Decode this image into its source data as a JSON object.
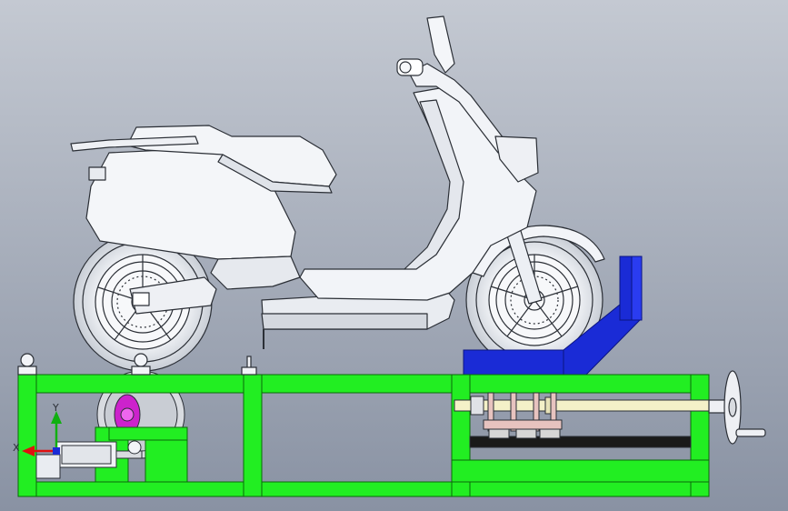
{
  "triad": {
    "x_label": "X",
    "y_label": "Y",
    "x_color": "#e01010",
    "y_color": "#10b010"
  },
  "colors": {
    "background_top": "#c4c9d2",
    "background_bottom": "#8992a3",
    "frame": "#22ee22",
    "fixture": "#1a2bd6",
    "scooter_body": "#f2f4f8",
    "scooter_line": "#2b2f36",
    "tire": "#e2e5ea",
    "roller": "#cc22cc",
    "rail": "#f4f1c8",
    "slide_block": "#e7c3bf",
    "base_plate": "#f0f0f0"
  },
  "parts": [
    "scooter",
    "rear-wheel",
    "front-wheel",
    "test-frame",
    "front-wheel-clamp",
    "roller-drum",
    "pneumatic-cylinder",
    "linear-rail",
    "slide-carriage",
    "handwheel",
    "lifting-eyebolt"
  ]
}
